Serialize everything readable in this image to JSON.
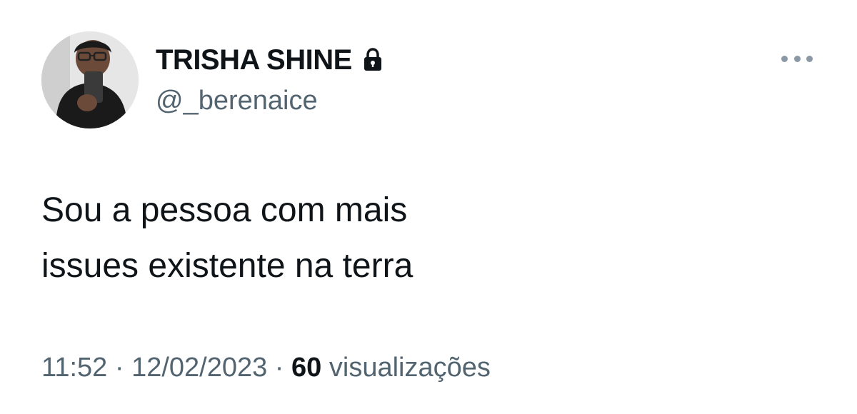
{
  "user": {
    "display_name": "TRISHA SHINE",
    "handle": "@_berenaice",
    "protected_icon": "lock-icon",
    "avatar_icon": "avatar-photo"
  },
  "tweet": {
    "text_line_1": "Sou a pessoa com mais",
    "text_line_2": "issues existente na terra"
  },
  "meta": {
    "time": "11:52",
    "separator_1": " · ",
    "date": "12/02/2023",
    "separator_2": " · ",
    "views_count": "60",
    "views_label": " visualizações"
  },
  "actions": {
    "more_icon": "more-horizontal-icon"
  },
  "colors": {
    "text_primary": "#0f1419",
    "text_secondary": "#536471",
    "background": "#ffffff"
  }
}
